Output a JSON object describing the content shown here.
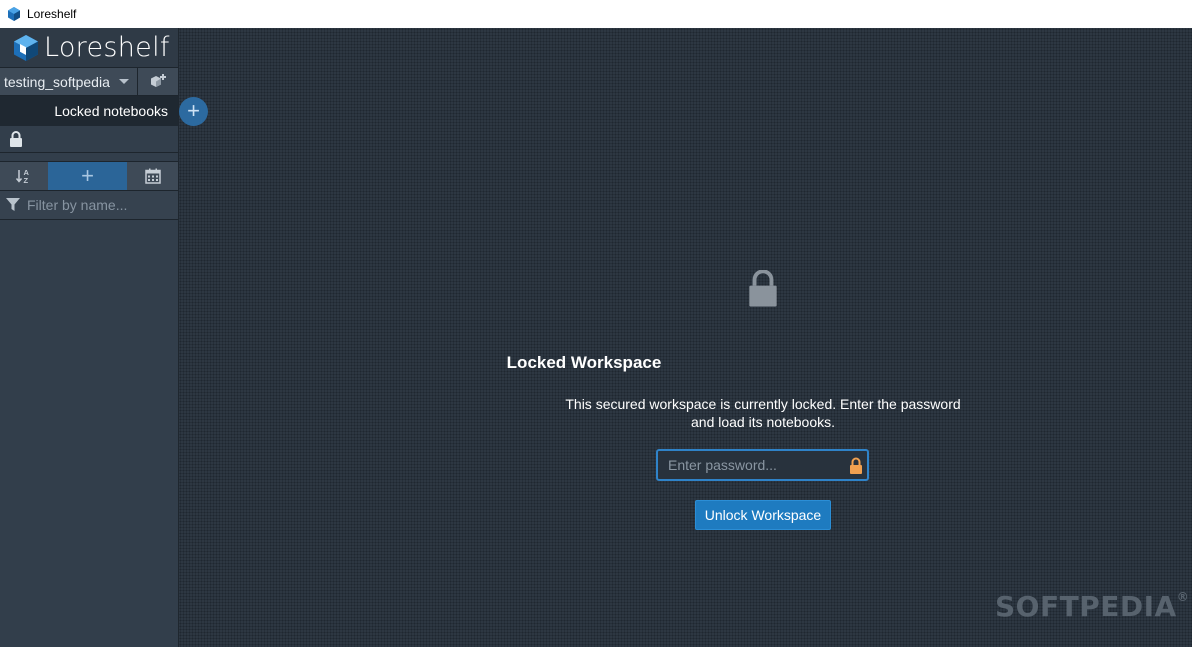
{
  "window": {
    "title": "Loreshelf"
  },
  "sidebar": {
    "logo_text": "Loreshelf",
    "workspace": {
      "selected": "testing_softpedia"
    },
    "locked_notebooks_label": "Locked notebooks",
    "add_notebook_symbol": "+",
    "toolbar": {
      "add_symbol": "+"
    },
    "filter": {
      "placeholder": "Filter by name..."
    }
  },
  "main": {
    "title": "Locked Workspace",
    "message": "This secured workspace is currently locked. Enter the password and load its notebooks.",
    "password": {
      "placeholder": "Enter password...",
      "value": ""
    },
    "unlock_label": "Unlock Workspace"
  },
  "watermark": {
    "text": "SOFTPEDIA",
    "mark": "®"
  },
  "colors": {
    "accent": "#1e7bc0",
    "sidebar_bg": "#323e4b",
    "main_bg": "#2d3742",
    "lock_accent": "#f0a050"
  },
  "icons": [
    "app-cube-icon",
    "logo-cube-icon",
    "add-workspace-icon",
    "lock-icon",
    "sort-az-icon",
    "calendar-icon",
    "filter-icon",
    "large-lock-icon",
    "password-lock-icon"
  ]
}
